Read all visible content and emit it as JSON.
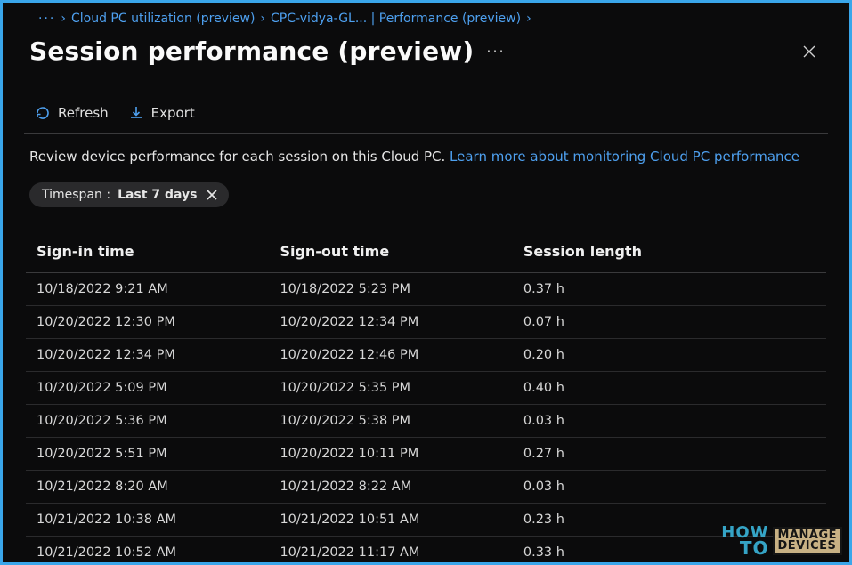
{
  "breadcrumb": {
    "dots": "···",
    "item1": "Cloud PC utilization (preview)",
    "item2": "CPC-vidya-GL... | Performance (preview)"
  },
  "header": {
    "title": "Session performance (preview)"
  },
  "toolbar": {
    "refresh_label": "Refresh",
    "export_label": "Export"
  },
  "description": {
    "text": "Review device performance for each session on this Cloud PC. ",
    "link": "Learn more about monitoring Cloud PC performance"
  },
  "filter": {
    "label": "Timespan : ",
    "value": "Last 7 days"
  },
  "table": {
    "columns": [
      "Sign-in time",
      "Sign-out time",
      "Session length"
    ],
    "rows": [
      {
        "in": "10/18/2022 9:21 AM",
        "out": "10/18/2022 5:23 PM",
        "len": "0.37 h"
      },
      {
        "in": "10/20/2022 12:30 PM",
        "out": "10/20/2022 12:34 PM",
        "len": "0.07 h"
      },
      {
        "in": "10/20/2022 12:34 PM",
        "out": "10/20/2022 12:46 PM",
        "len": "0.20 h"
      },
      {
        "in": "10/20/2022 5:09 PM",
        "out": "10/20/2022 5:35 PM",
        "len": "0.40 h"
      },
      {
        "in": "10/20/2022 5:36 PM",
        "out": "10/20/2022 5:38 PM",
        "len": "0.03 h"
      },
      {
        "in": "10/20/2022 5:51 PM",
        "out": "10/20/2022 10:11 PM",
        "len": "0.27 h"
      },
      {
        "in": "10/21/2022 8:20 AM",
        "out": "10/21/2022 8:22 AM",
        "len": "0.03 h"
      },
      {
        "in": "10/21/2022 10:38 AM",
        "out": "10/21/2022 10:51 AM",
        "len": "0.23 h"
      },
      {
        "in": "10/21/2022 10:52 AM",
        "out": "10/21/2022 11:17 AM",
        "len": "0.33 h"
      }
    ]
  },
  "watermark": {
    "how": "HOW",
    "to": "TO",
    "line1": "MANAGE",
    "line2": "DEVICES"
  }
}
